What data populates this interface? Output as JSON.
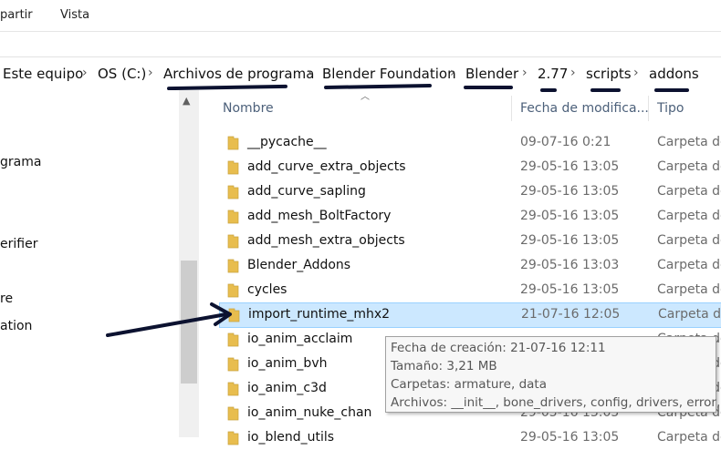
{
  "ribbon": {
    "tabs": [
      "partir",
      "Vista"
    ]
  },
  "breadcrumb": [
    "Este equipo",
    "OS (C:)",
    "Archivos de programa",
    "Blender Foundation",
    "Blender",
    "2.77",
    "scripts",
    "addons"
  ],
  "nav_pane": [
    "grama",
    "erifier",
    "re",
    "ation"
  ],
  "columns": {
    "name": "Nombre",
    "date": "Fecha de modifica...",
    "type": "Tipo"
  },
  "files": [
    {
      "name": "__pycache__",
      "date": "09-07-16 0:21",
      "type": "Carpeta de"
    },
    {
      "name": "add_curve_extra_objects",
      "date": "29-05-16 13:05",
      "type": "Carpeta de"
    },
    {
      "name": "add_curve_sapling",
      "date": "29-05-16 13:05",
      "type": "Carpeta de"
    },
    {
      "name": "add_mesh_BoltFactory",
      "date": "29-05-16 13:05",
      "type": "Carpeta de"
    },
    {
      "name": "add_mesh_extra_objects",
      "date": "29-05-16 13:05",
      "type": "Carpeta de"
    },
    {
      "name": "Blender_Addons",
      "date": "29-05-16 13:03",
      "type": "Carpeta de"
    },
    {
      "name": "cycles",
      "date": "29-05-16 13:05",
      "type": "Carpeta de"
    },
    {
      "name": "import_runtime_mhx2",
      "date": "21-07-16 12:05",
      "type": "Carpeta de",
      "selected": true
    },
    {
      "name": "io_anim_acclaim",
      "date": "",
      "type": "Carpeta de"
    },
    {
      "name": "io_anim_bvh",
      "date": "",
      "type": "Carpeta de"
    },
    {
      "name": "io_anim_c3d",
      "date": "",
      "type": "Carpeta de"
    },
    {
      "name": "io_anim_nuke_chan",
      "date": "29-05-16 13:05",
      "type": "Carpeta de"
    },
    {
      "name": "io_blend_utils",
      "date": "29-05-16 13:05",
      "type": "Carpeta de"
    }
  ],
  "tooltip": {
    "created": "Fecha de creación: 21-07-16 12:11",
    "size": "Tamaño: 3,21 MB",
    "folders": "Carpetas: armature, data",
    "files": "Archivos: __init__, bone_drivers, config, drivers, error, ..."
  },
  "colors": {
    "folder": "#e8bd4e",
    "selection": "#cce8ff",
    "annotation_ink": "#0c1230"
  }
}
